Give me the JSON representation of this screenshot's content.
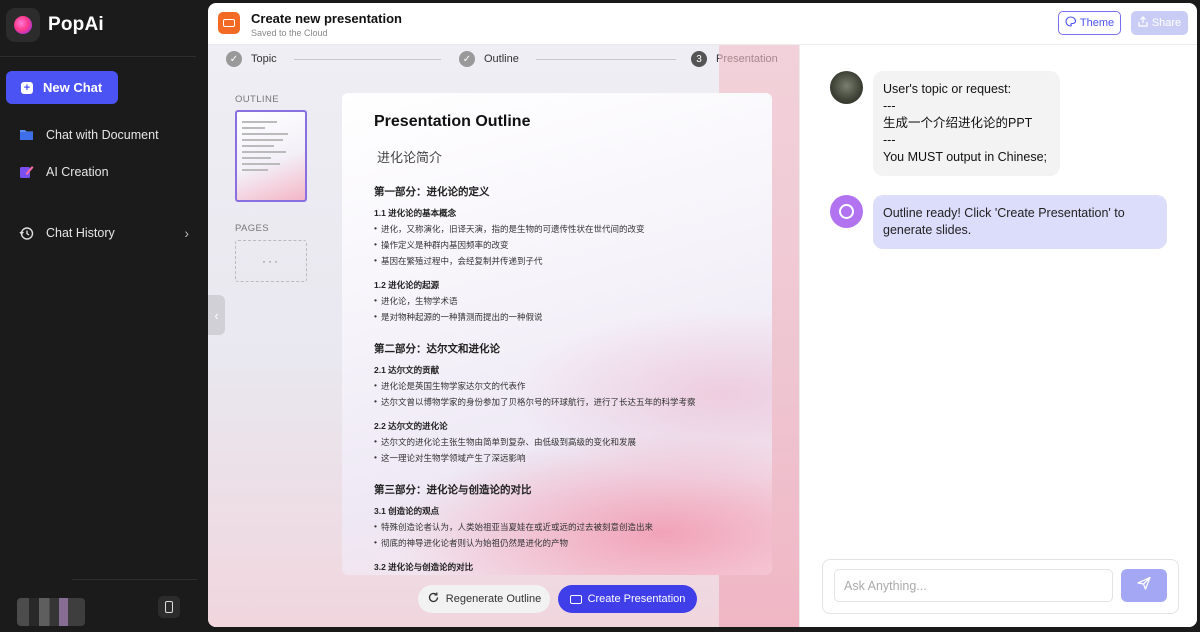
{
  "sidebar": {
    "brand": "PopAi",
    "new_chat": "New Chat",
    "items": [
      {
        "label": "Chat with Document",
        "icon": "folder-icon"
      },
      {
        "label": "AI Creation",
        "icon": "pen-icon"
      },
      {
        "label": "Chat History",
        "icon": "history-icon"
      }
    ]
  },
  "header": {
    "title": "Create new presentation",
    "subtitle": "Saved to the Cloud",
    "theme_label": "Theme",
    "share_label": "Share"
  },
  "steps": [
    {
      "label": "Topic",
      "state": "done"
    },
    {
      "label": "Outline",
      "state": "done"
    },
    {
      "label": "Presentation",
      "number": "3",
      "state": "current"
    }
  ],
  "left_panel": {
    "outline_label": "OUTLINE",
    "pages_label": "PAGES",
    "pages_placeholder": "···"
  },
  "document": {
    "title": "Presentation Outline",
    "topic": "进化论简介",
    "sections": [
      {
        "heading": "第一部分：进化论的定义",
        "subsections": [
          {
            "heading": "1.1 进化论的基本概念",
            "bullets": [
              "进化，又称演化，旧译天演，指的是生物的可遗传性状在世代间的改变",
              "操作定义是种群内基因频率的改变",
              "基因在繁殖过程中，会经复制并传递到子代"
            ]
          },
          {
            "heading": "1.2 进化论的起源",
            "bullets": [
              "进化论，生物学术语",
              "是对物种起源的一种猜测而提出的一种假说"
            ]
          }
        ]
      },
      {
        "heading": "第二部分：达尔文和进化论",
        "subsections": [
          {
            "heading": "2.1 达尔文的贡献",
            "bullets": [
              "进化论是英国生物学家达尔文的代表作",
              "达尔文曾以博物学家的身份参加了贝格尔号的环球航行，进行了长达五年的科学考察"
            ]
          },
          {
            "heading": "2.2 达尔文的进化论",
            "bullets": [
              "达尔文的进化论主张生物由简单到复杂、由低级到高级的变化和发展",
              "这一理论对生物学领域产生了深远影响"
            ]
          }
        ]
      },
      {
        "heading": "第三部分：进化论与创造论的对比",
        "subsections": [
          {
            "heading": "3.1 创造论的观点",
            "bullets": [
              "特殊创造论者认为，人类始祖亚当夏娃在或近或远的过去被刻意创造出来",
              "彻底的神导进化论者则认为始祖仍然是进化的产物"
            ]
          },
          {
            "heading": "3.2 进化论与创造论的对比",
            "bullets": []
          }
        ]
      }
    ]
  },
  "actions": {
    "regenerate": "Regenerate Outline",
    "create": "Create Presentation"
  },
  "chat": {
    "messages": [
      {
        "role": "user",
        "text": "User's topic or request:\n---\n生成一个介绍进化论的PPT\n---\nYou MUST output in Chinese;"
      },
      {
        "role": "assistant",
        "text": "Outline ready! Click 'Create Presentation' to generate slides."
      }
    ],
    "input_placeholder": "Ask Anything..."
  },
  "colors": {
    "accent": "#4b53f5",
    "create_button": "#3f3ee9",
    "sidebar_bg": "#1b1b1b",
    "brand_orange": "#f36a24"
  }
}
